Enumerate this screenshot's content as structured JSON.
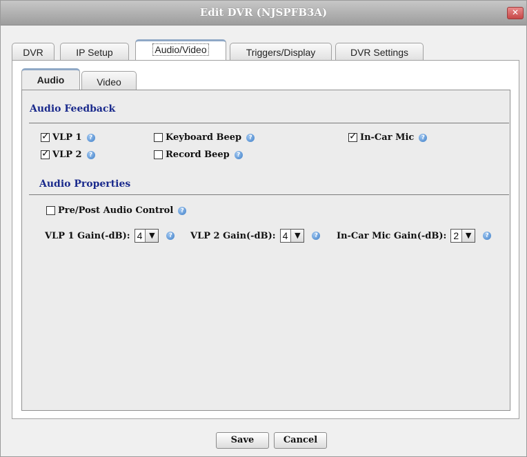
{
  "window": {
    "title": "Edit DVR (NJSPFB3A)",
    "close_icon": "close-icon"
  },
  "tabs": [
    {
      "label": "DVR",
      "active": false
    },
    {
      "label": "IP Setup",
      "active": false
    },
    {
      "label": "Audio/Video",
      "active": true
    },
    {
      "label": "Triggers/Display",
      "active": false
    },
    {
      "label": "DVR Settings",
      "active": false
    }
  ],
  "subtabs": [
    {
      "label": "Audio",
      "active": true
    },
    {
      "label": "Video",
      "active": false
    }
  ],
  "audio_feedback": {
    "title": "Audio Feedback",
    "vlp1": {
      "label": "VLP 1",
      "checked": true
    },
    "vlp2": {
      "label": "VLP 2",
      "checked": true
    },
    "keyboard_beep": {
      "label": "Keyboard Beep",
      "checked": false
    },
    "record_beep": {
      "label": "Record Beep",
      "checked": false
    },
    "incar_mic": {
      "label": "In-Car Mic",
      "checked": true
    }
  },
  "audio_properties": {
    "title": "Audio Properties",
    "pre_post": {
      "label": "Pre/Post Audio Control",
      "checked": false
    },
    "vlp1_gain": {
      "label": "VLP 1 Gain(-dB):",
      "value": "4"
    },
    "vlp2_gain": {
      "label": "VLP 2 Gain(-dB):",
      "value": "4"
    },
    "incar_gain": {
      "label": "In-Car Mic Gain(-dB):",
      "value": "2"
    }
  },
  "buttons": {
    "save": "Save",
    "cancel": "Cancel"
  },
  "colors": {
    "section_title": "#1a2a8c",
    "help_icon": "#3f7fc8",
    "close_button": "#c74848"
  }
}
